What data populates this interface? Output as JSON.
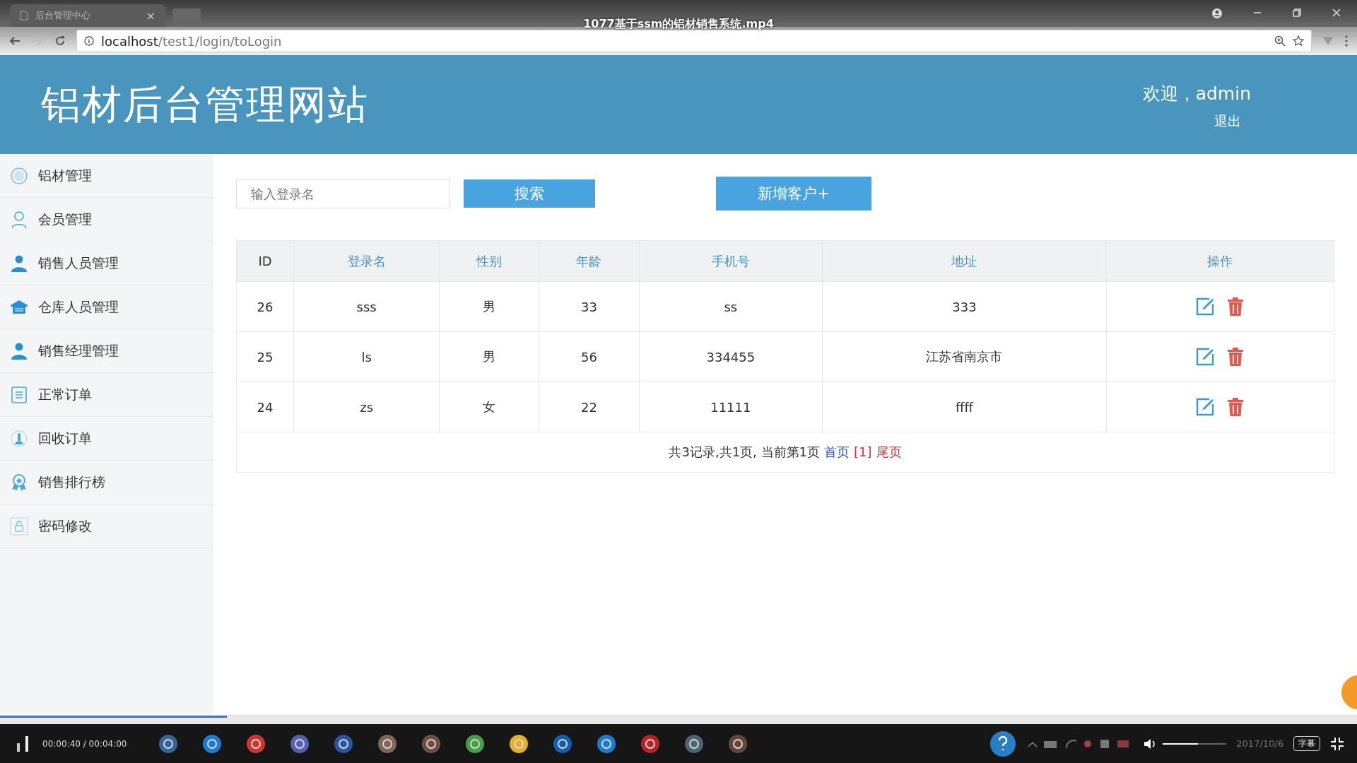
{
  "browser": {
    "tab_title": "后台管理中心",
    "tab_close": "×",
    "url_host": "localhost",
    "url_path": "/test1/login/toLogin"
  },
  "video": {
    "title": "1077基于ssm的铝材销售系统.mp4",
    "time": "00:00:40 / 00:04:00",
    "progress": {
      "level": 0.167
    },
    "volume": {
      "level": 0.55
    },
    "subtitle_button": "字幕"
  },
  "header": {
    "title": "铝材后台管理网站",
    "welcome": "欢迎，admin",
    "logout": "退出"
  },
  "sidebar": {
    "items": [
      {
        "label": "铝材管理"
      },
      {
        "label": "会员管理"
      },
      {
        "label": "销售人员管理"
      },
      {
        "label": "仓库人员管理"
      },
      {
        "label": "销售经理管理"
      },
      {
        "label": "正常订单"
      },
      {
        "label": "回收订单"
      },
      {
        "label": "销售排行榜"
      },
      {
        "label": "密码修改"
      }
    ]
  },
  "search": {
    "placeholder": "输入登录名",
    "button": "搜索"
  },
  "add_button": "新增客户+",
  "table": {
    "columns": [
      "ID",
      "登录名",
      "性别",
      "年龄",
      "手机号",
      "地址",
      "操作"
    ],
    "rows": [
      {
        "cells": [
          "26",
          "sss",
          "男",
          "33",
          "ss",
          "333"
        ]
      },
      {
        "cells": [
          "25",
          "ls",
          "男",
          "56",
          "334455",
          "江苏省南京市"
        ]
      },
      {
        "cells": [
          "24",
          "zs",
          "女",
          "22",
          "11111",
          "ffff"
        ]
      }
    ]
  },
  "pagination": {
    "summary": "共3记录,共1页, 当前第1页",
    "first": "首页",
    "current": "[1]",
    "last": "尾页"
  },
  "taskbar": {
    "date": "2017/10/6"
  }
}
